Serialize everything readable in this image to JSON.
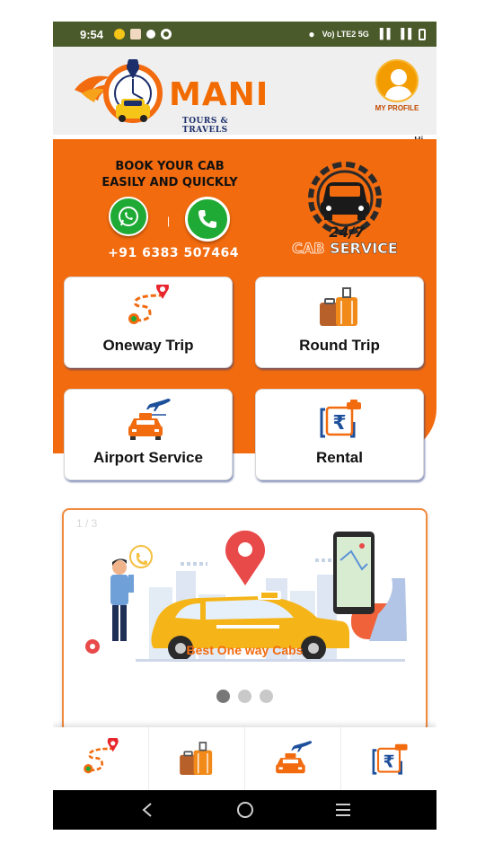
{
  "status_bar": {
    "time": "9:54",
    "network": "Vo) LTE2 5G"
  },
  "header": {
    "logo_name": "MANI",
    "logo_subtitle": "TOURS & TRAVELS",
    "profile_label": "MY PROFILE",
    "greeting": "Hi,"
  },
  "hero": {
    "title_line1": "BOOK YOUR CAB",
    "title_line2": "EASILY AND QUICKLY",
    "divider": "|",
    "phone_number": "+91 6383 507464",
    "badge_hours": "24/7",
    "badge_cab": "CAB",
    "badge_service": "SERVICE"
  },
  "services": {
    "oneway": "Oneway Trip",
    "round": "Round Trip",
    "airport": "Airport Service",
    "rental": "Rental"
  },
  "banner": {
    "slide_counter": "1 / 3",
    "caption": "Best One way Cabs",
    "slides_total": 3,
    "active_slide": 1
  },
  "colors": {
    "brand_orange": "#f26b0f",
    "status_bar": "#4a5a2a",
    "whatsapp_green": "#1faa35",
    "navy": "#1d2f6b"
  }
}
